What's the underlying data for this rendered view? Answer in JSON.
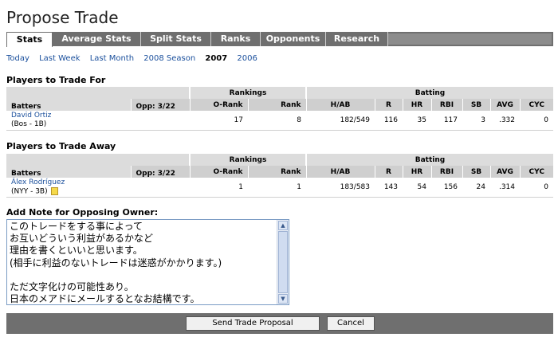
{
  "page": {
    "title": "Propose Trade"
  },
  "tabs": [
    {
      "label": "Stats"
    },
    {
      "label": "Average Stats"
    },
    {
      "label": "Split Stats"
    },
    {
      "label": "Ranks"
    },
    {
      "label": "Opponents"
    },
    {
      "label": "Research"
    }
  ],
  "periods": [
    "Today",
    "Last Week",
    "Last Month",
    "2008 Season",
    "2007",
    "2006"
  ],
  "sections": {
    "trade_for": "Players to Trade For",
    "trade_away": "Players to Trade Away"
  },
  "table": {
    "group_rankings": "Rankings",
    "group_batting": "Batting",
    "col_batters": "Batters",
    "col_opp": "Opp: 3/22",
    "cols": [
      "O-Rank",
      "Rank",
      "H/AB",
      "R",
      "HR",
      "RBI",
      "SB",
      "AVG",
      "CYC"
    ]
  },
  "trade_for_player": {
    "name": "David Ortiz",
    "team": "(Bos - 1B)",
    "opp": "",
    "orank": "17",
    "rank": "8",
    "hab": "182/549",
    "r": "116",
    "hr": "35",
    "rbi": "117",
    "sb": "3",
    "avg": ".332",
    "cyc": "0"
  },
  "trade_away_player": {
    "name": "Álex Rodríguez",
    "team": "(NYY - 3B)",
    "opp": "",
    "orank": "1",
    "rank": "1",
    "hab": "183/583",
    "r": "143",
    "hr": "54",
    "rbi": "156",
    "sb": "24",
    "avg": ".314",
    "cyc": "0"
  },
  "note": {
    "label": "Add Note for Opposing Owner:",
    "text": "このトレードをする事によって\nお互いどういう利益があるかなど\n理由を書くといいと思います。\n(相手に利益のないトレードは迷惑がかかります。)\n\nただ文字化けの可能性あり。\n日本のメアドにメールするとなお結構です。"
  },
  "buttons": {
    "send": "Send Trade Proposal",
    "cancel": "Cancel"
  }
}
